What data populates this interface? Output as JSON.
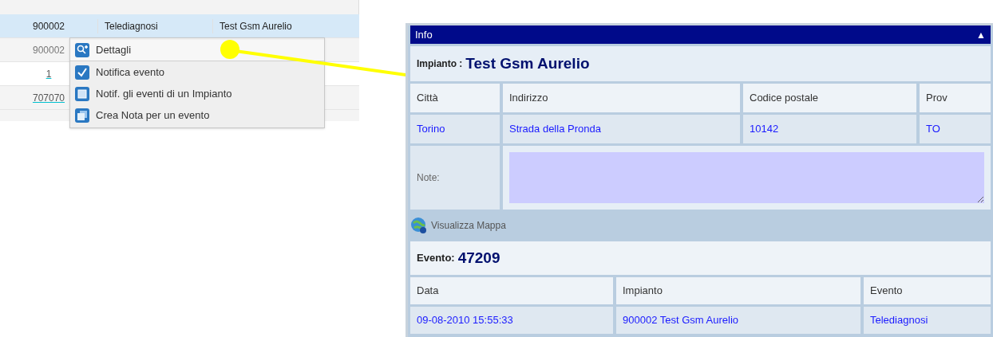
{
  "table": {
    "rows": [
      {
        "selected": true,
        "cells": [
          "900002",
          "Telediagnosi",
          "Test Gsm Aurelio"
        ]
      },
      {
        "selected": false,
        "cells": [
          "900002"
        ]
      },
      {
        "selected": false,
        "link": true,
        "cells": [
          "1"
        ]
      },
      {
        "selected": false,
        "link": true,
        "cells": [
          "707070"
        ]
      }
    ]
  },
  "context_menu": {
    "items": [
      {
        "label": "Dettagli",
        "kind": "zoom",
        "highlighted": true
      },
      {
        "label": "Notifica evento",
        "kind": "check",
        "highlighted": false
      },
      {
        "label": "Notif. gli eventi di un Impianto",
        "kind": "window",
        "highlighted": false
      },
      {
        "label": "Crea Nota per un evento",
        "kind": "note",
        "highlighted": false
      }
    ]
  },
  "info_panel": {
    "title": "Info",
    "collapse_glyph": "▲",
    "impianto_label": "Impianto :",
    "impianto_value": "Test Gsm Aurelio",
    "address_columns": [
      "Città",
      "Indirizzo",
      "Codice postale",
      "Prov"
    ],
    "address_values": [
      "Torino",
      "Strada della Pronda",
      "10142",
      "TO"
    ],
    "note_label": "Note:",
    "map_link": "Visualizza Mappa",
    "evento_label": "Evento:",
    "evento_value": "47209",
    "event_columns": [
      "Data",
      "Impianto",
      "Evento"
    ],
    "event_values": [
      "09-08-2010 15:55:33",
      "900002 Test Gsm Aurelio",
      "Telediagnosi"
    ]
  }
}
